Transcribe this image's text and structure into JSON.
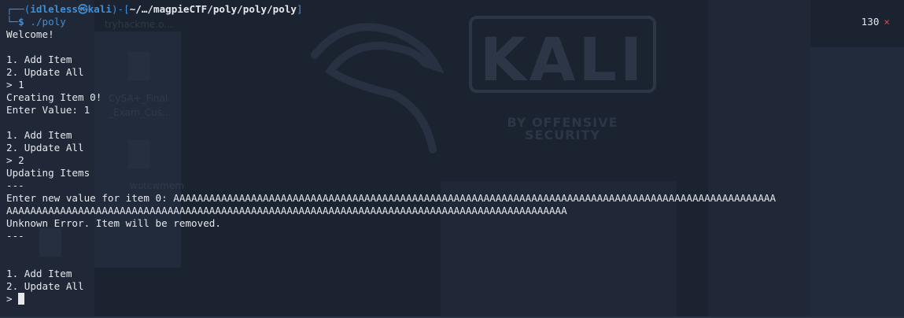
{
  "prompt": {
    "user_host": "idleless㉿kali",
    "path": "~/…/magpieCTF/poly/poly/poly",
    "command": "./poly",
    "exit_code": "130",
    "error_mark": "×"
  },
  "output_lines": [
    "Welcome!",
    "",
    "1. Add Item",
    "2. Update All",
    "> 1",
    "Creating Item 0!",
    "Enter Value: 1",
    "",
    "1. Add Item",
    "2. Update All",
    "> 2",
    "Updating Items",
    "---",
    "Enter new value for item 0: AAAAAAAAAAAAAAAAAAAAAAAAAAAAAAAAAAAAAAAAAAAAAAAAAAAAAAAAAAAAAAAAAAAAAAAAAAAAAAAAAAAAAAAAAAAAAAAAAAAAA",
    "AAAAAAAAAAAAAAAAAAAAAAAAAAAAAAAAAAAAAAAAAAAAAAAAAAAAAAAAAAAAAAAAAAAAAAAAAAAAAAAAAAAAAAAAAAAAAA",
    "Unknown Error. Item will be removed.",
    "---",
    "",
    "",
    "1. Add Item",
    "2. Update All"
  ],
  "final_prompt": ">",
  "wallpaper": {
    "logo_text": "KALI",
    "logo_sub": "BY OFFENSIVE SECURITY",
    "desktop_labels": [
      "tryhackme.o...",
      "CySA+_Final",
      "_Exam_Cus...",
      "wotcwmem"
    ]
  },
  "colors": {
    "background": "#1b2230",
    "prompt": "#3f8fd6",
    "text": "#e6e8ec",
    "error": "#e0463f"
  }
}
